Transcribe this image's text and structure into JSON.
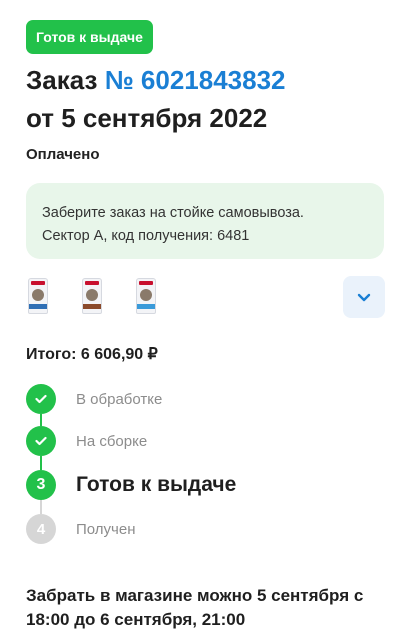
{
  "status_chip": "Готов к выдаче",
  "order": {
    "title_prefix": "Заказ",
    "number": "№ 6021843832",
    "date": "от 5 сентября 2022",
    "payment_status": "Оплачено"
  },
  "pickup_info": {
    "line1": "Заберите заказ на стойке самовывоза.",
    "line2": "Сектор А, код получения: 6481"
  },
  "items": [
    {
      "icon": "cat-food-bag-icon"
    },
    {
      "icon": "cat-food-bag-icon"
    },
    {
      "icon": "cat-food-bag-icon"
    }
  ],
  "expand_icon": "chevron-down-icon",
  "total": "Итого: 6 606,90 ₽",
  "steps": [
    {
      "marker": "",
      "label": "В обработке",
      "state": "done"
    },
    {
      "marker": "",
      "label": "На сборке",
      "state": "done"
    },
    {
      "marker": "3",
      "label": "Готов к выдаче",
      "state": "active"
    },
    {
      "marker": "4",
      "label": "Получен",
      "state": "pending"
    }
  ],
  "pickup_window": "Забрать в магазине можно 5 сентября с 18:00 до 6 сентября, 21:00",
  "colors": {
    "accent_green": "#22c14a",
    "link_blue": "#1a7fd4",
    "info_bg": "#e8f6ea",
    "button_bg": "#eaf2fb",
    "pending_gray": "#d6d6d6"
  }
}
